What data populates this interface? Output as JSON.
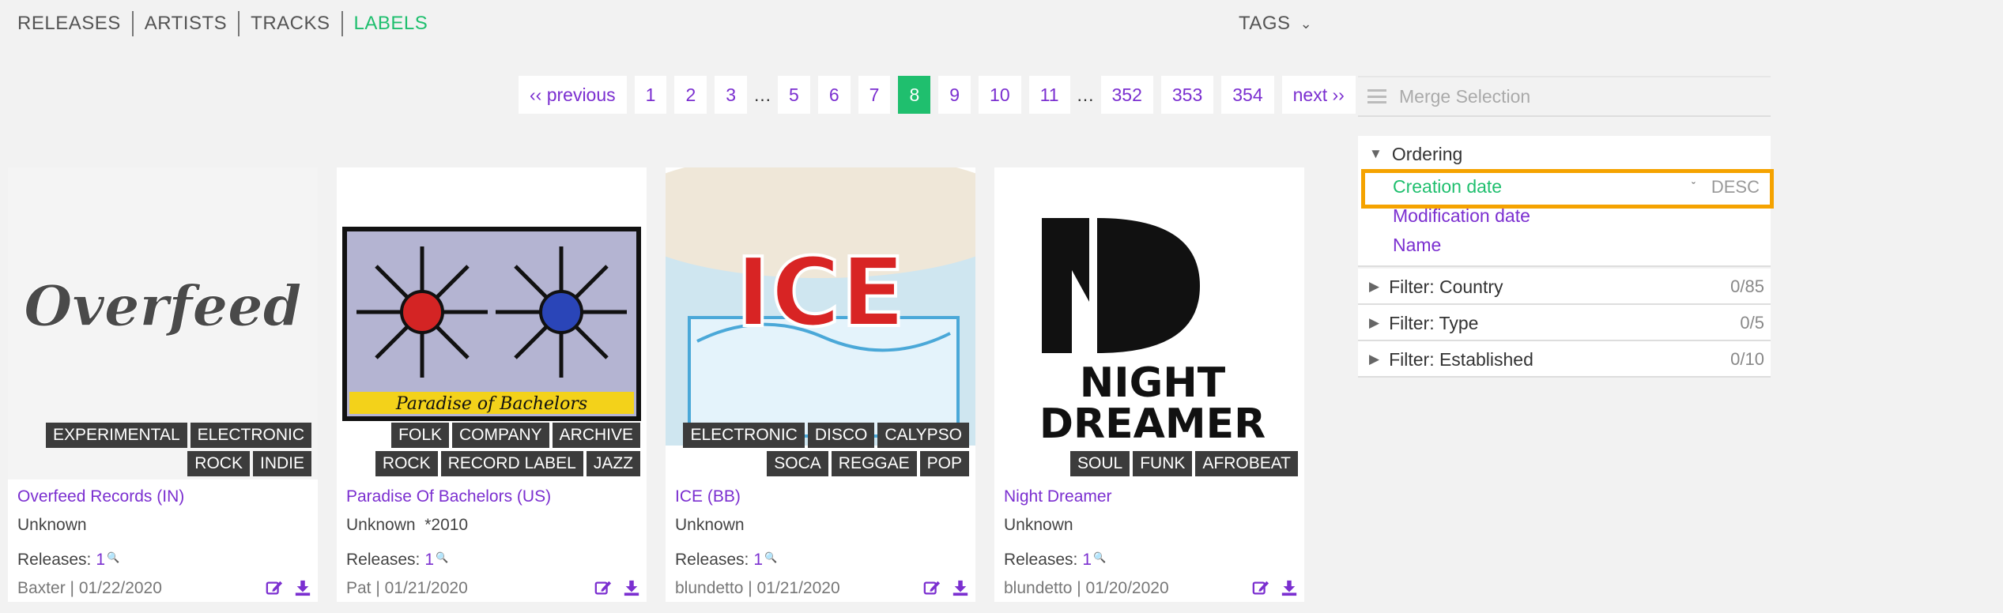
{
  "nav": {
    "tabs": [
      "RELEASES",
      "ARTISTS",
      "TRACKS",
      "LABELS"
    ],
    "active": "LABELS",
    "tags_label": "TAGS"
  },
  "pagination": {
    "previous": "‹‹ previous",
    "next": "next ››",
    "pages": [
      "1",
      "2",
      "3",
      "…",
      "5",
      "6",
      "7",
      "8",
      "9",
      "10",
      "11",
      "…",
      "352",
      "353",
      "354"
    ],
    "current": "8"
  },
  "cards": [
    {
      "name": "Overfeed Records (IN)",
      "info": "Unknown",
      "releases_label": "Releases:",
      "releases_count": "1",
      "meta": "Baxter | 01/22/2020",
      "tags": [
        "EXPERIMENTAL",
        "ELECTRONIC",
        "ROCK",
        "INDIE"
      ],
      "logo_text": "Overfeed"
    },
    {
      "name": "Paradise Of Bachelors (US)",
      "info": "Unknown  *2010",
      "releases_label": "Releases:",
      "releases_count": "1",
      "meta": "Pat | 01/21/2020",
      "tags": [
        "FOLK",
        "COMPANY",
        "ARCHIVE",
        "ROCK",
        "RECORD LABEL",
        "JAZZ"
      ],
      "logo_text": "Paradise of Bachelors"
    },
    {
      "name": "ICE (BB)",
      "info": "Unknown",
      "releases_label": "Releases:",
      "releases_count": "1",
      "meta": "blundetto | 01/21/2020",
      "tags": [
        "ELECTRONIC",
        "DISCO",
        "CALYPSO",
        "SOCA",
        "REGGAE",
        "POP"
      ],
      "logo_text": "ICE"
    },
    {
      "name": "Night Dreamer",
      "info": "Unknown",
      "releases_label": "Releases:",
      "releases_count": "1",
      "meta": "blundetto | 01/20/2020",
      "tags": [
        "SOUL",
        "FUNK",
        "AFROBEAT"
      ],
      "logo_text": "NIGHT DREAMER"
    }
  ],
  "sidebar": {
    "merge_label": "Merge Selection",
    "ordering": {
      "title": "Ordering",
      "options": [
        "Creation date",
        "Modification date",
        "Name"
      ],
      "selected": "Creation date",
      "direction": "DESC"
    },
    "filters": [
      {
        "label": "Filter: Country",
        "count": "0/85"
      },
      {
        "label": "Filter: Type",
        "count": "0/5"
      },
      {
        "label": "Filter: Established",
        "count": "0/10"
      }
    ]
  },
  "colors": {
    "accent_green": "#1fbf6e",
    "link_purple": "#7b2fd0",
    "highlight_orange": "#f5a300",
    "tag_bg": "#3c3c3c"
  }
}
